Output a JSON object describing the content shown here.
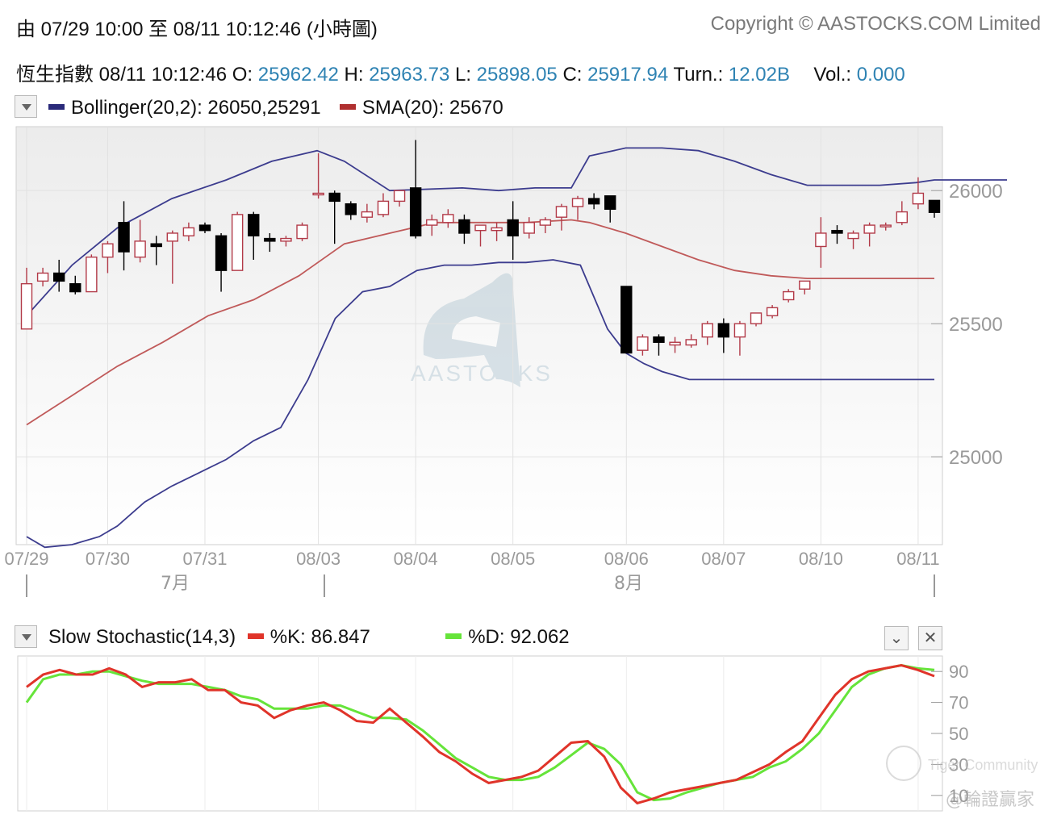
{
  "header": {
    "range_text": "由  07/29 10:00 至  08/11 10:12:46 (小時圖)",
    "copyright": "Copyright © AASTOCKS.COM Limited"
  },
  "quote": {
    "name": "恆生指數",
    "time": "08/11 10:12:46",
    "o_label": "O:",
    "o": "25962.42",
    "h_label": "H:",
    "h": "25963.73",
    "l_label": "L:",
    "l": "25898.05",
    "c_label": "C:",
    "c": "25917.94",
    "turn_label": "Turn.:",
    "turn": "12.02B",
    "vol_label": "Vol.:",
    "vol": "0.000"
  },
  "legend_main": {
    "boll_text": "Bollinger(20,2): 26050,25291",
    "sma_text": "SMA(20): 25670"
  },
  "legend_stoch": {
    "title": "Slow Stochastic(14,3)",
    "k_text": "%K: 86.847",
    "d_text": "%D: 92.062"
  },
  "watermark": {
    "logo_text": "AASTOCKS",
    "tiger_text": "Tiger Community",
    "handle_text": "@輪證贏家"
  },
  "colors": {
    "up": "#b23a48",
    "down": "#000000",
    "boll": "#3c3c8e",
    "sma": "#c05a5a",
    "k": "#e0342a",
    "d": "#66e43a",
    "label": "#9a9a9a"
  },
  "chart_data": [
    {
      "type": "candlestick",
      "title": "恆生指數",
      "x_ticks": [
        "07/29",
        "07/30",
        "07/31",
        "08/03",
        "08/04",
        "08/05",
        "08/06",
        "08/07",
        "08/10",
        "08/11"
      ],
      "months": [
        "7月",
        "8月"
      ],
      "y_ticks": [
        25000,
        25500,
        26000
      ],
      "ylim": [
        24670,
        26240
      ],
      "candles": [
        {
          "o": 25480,
          "h": 25710,
          "l": 25480,
          "c": 25650
        },
        {
          "o": 25660,
          "h": 25710,
          "l": 25640,
          "c": 25690
        },
        {
          "o": 25690,
          "h": 25740,
          "l": 25620,
          "c": 25660
        },
        {
          "o": 25650,
          "h": 25680,
          "l": 25610,
          "c": 25620
        },
        {
          "o": 25620,
          "h": 25760,
          "l": 25620,
          "c": 25750
        },
        {
          "o": 25750,
          "h": 25810,
          "l": 25690,
          "c": 25800
        },
        {
          "o": 25880,
          "h": 25960,
          "l": 25700,
          "c": 25770
        },
        {
          "o": 25750,
          "h": 25890,
          "l": 25730,
          "c": 25810
        },
        {
          "o": 25800,
          "h": 25830,
          "l": 25720,
          "c": 25790
        },
        {
          "o": 25810,
          "h": 25850,
          "l": 25650,
          "c": 25840
        },
        {
          "o": 25830,
          "h": 25880,
          "l": 25810,
          "c": 25860
        },
        {
          "o": 25870,
          "h": 25880,
          "l": 25840,
          "c": 25850
        },
        {
          "o": 25830,
          "h": 25840,
          "l": 25620,
          "c": 25700
        },
        {
          "o": 25700,
          "h": 25920,
          "l": 25700,
          "c": 25910
        },
        {
          "o": 25910,
          "h": 25920,
          "l": 25740,
          "c": 25830
        },
        {
          "o": 25820,
          "h": 25840,
          "l": 25770,
          "c": 25810
        },
        {
          "o": 25810,
          "h": 25830,
          "l": 25790,
          "c": 25820
        },
        {
          "o": 25820,
          "h": 25880,
          "l": 25810,
          "c": 25870
        },
        {
          "o": 25990,
          "h": 26140,
          "l": 25970,
          "c": 25990
        },
        {
          "o": 25990,
          "h": 26000,
          "l": 25800,
          "c": 25960
        },
        {
          "o": 25950,
          "h": 25960,
          "l": 25890,
          "c": 25910
        },
        {
          "o": 25900,
          "h": 25950,
          "l": 25880,
          "c": 25920
        },
        {
          "o": 25910,
          "h": 25990,
          "l": 25900,
          "c": 25960
        },
        {
          "o": 25960,
          "h": 26000,
          "l": 25940,
          "c": 26000
        },
        {
          "o": 26010,
          "h": 26190,
          "l": 25820,
          "c": 25830
        },
        {
          "o": 25870,
          "h": 25910,
          "l": 25830,
          "c": 25890
        },
        {
          "o": 25880,
          "h": 25930,
          "l": 25860,
          "c": 25910
        },
        {
          "o": 25890,
          "h": 25910,
          "l": 25800,
          "c": 25840
        },
        {
          "o": 25850,
          "h": 25870,
          "l": 25790,
          "c": 25870
        },
        {
          "o": 25850,
          "h": 25880,
          "l": 25810,
          "c": 25860
        },
        {
          "o": 25890,
          "h": 25960,
          "l": 25740,
          "c": 25830
        },
        {
          "o": 25840,
          "h": 25900,
          "l": 25820,
          "c": 25880
        },
        {
          "o": 25870,
          "h": 25900,
          "l": 25840,
          "c": 25890
        },
        {
          "o": 25900,
          "h": 25950,
          "l": 25850,
          "c": 25940
        },
        {
          "o": 25940,
          "h": 25980,
          "l": 25890,
          "c": 25970
        },
        {
          "o": 25970,
          "h": 25990,
          "l": 25930,
          "c": 25950
        },
        {
          "o": 25980,
          "h": 25980,
          "l": 25880,
          "c": 25930
        },
        {
          "o": 25640,
          "h": 25640,
          "l": 25390,
          "c": 25390
        },
        {
          "o": 25400,
          "h": 25460,
          "l": 25380,
          "c": 25450
        },
        {
          "o": 25450,
          "h": 25460,
          "l": 25380,
          "c": 25430
        },
        {
          "o": 25420,
          "h": 25450,
          "l": 25390,
          "c": 25430
        },
        {
          "o": 25420,
          "h": 25460,
          "l": 25410,
          "c": 25440
        },
        {
          "o": 25450,
          "h": 25510,
          "l": 25420,
          "c": 25500
        },
        {
          "o": 25500,
          "h": 25520,
          "l": 25390,
          "c": 25450
        },
        {
          "o": 25450,
          "h": 25510,
          "l": 25380,
          "c": 25500
        },
        {
          "o": 25500,
          "h": 25540,
          "l": 25490,
          "c": 25540
        },
        {
          "o": 25530,
          "h": 25570,
          "l": 25520,
          "c": 25560
        },
        {
          "o": 25590,
          "h": 25630,
          "l": 25580,
          "c": 25620
        },
        {
          "o": 25630,
          "h": 25660,
          "l": 25610,
          "c": 25660
        },
        {
          "o": 25790,
          "h": 25900,
          "l": 25710,
          "c": 25840
        },
        {
          "o": 25850,
          "h": 25870,
          "l": 25800,
          "c": 25840
        },
        {
          "o": 25820,
          "h": 25850,
          "l": 25780,
          "c": 25840
        },
        {
          "o": 25840,
          "h": 25880,
          "l": 25790,
          "c": 25870
        },
        {
          "o": 25870,
          "h": 25880,
          "l": 25850,
          "c": 25870
        },
        {
          "o": 25880,
          "h": 25960,
          "l": 25870,
          "c": 25920
        },
        {
          "o": 25950,
          "h": 26050,
          "l": 25930,
          "c": 25990
        },
        {
          "o": 25963,
          "h": 25963,
          "l": 25898,
          "c": 25918
        }
      ],
      "series": [
        {
          "name": "Bollinger upper",
          "values": [
            25530,
            25580,
            25630,
            25700,
            25760,
            25780,
            25820,
            25850,
            25880,
            25920,
            25960,
            25990,
            26010,
            26040,
            26070,
            26080,
            26090,
            26100,
            26110,
            26130,
            26140,
            26120,
            26090,
            26060,
            26030,
            26000,
            25990,
            26000,
            26010,
            26010,
            26010,
            26010,
            26010,
            26010,
            26010,
            26010,
            26010,
            26010,
            26010,
            26010,
            26010,
            26010,
            26010,
            26010,
            26010,
            26010,
            26010,
            26010,
            26010,
            26010,
            26010,
            26010,
            26010,
            26010,
            26010,
            26010,
            26010,
            26010,
            26010,
            26010,
            26010,
            26010,
            26010,
            26010,
            26010,
            26010
          ]
        },
        {
          "name": "SMA",
          "values": [
            25120,
            25140,
            25170,
            25190,
            25210,
            25230,
            25250,
            25270,
            25300,
            25320,
            25340,
            25360,
            25380,
            25400,
            25420,
            25440,
            25460,
            25470,
            25490,
            25510,
            25530,
            25550,
            25560,
            25580,
            25600,
            25620,
            25640,
            25660,
            25710,
            25740,
            25760,
            25770,
            25780,
            25790,
            25800,
            25820,
            25840,
            25850,
            25860,
            25870,
            25870,
            25870,
            25870,
            25870,
            25870,
            25870,
            25870,
            25870,
            25870,
            25870,
            25870,
            25870,
            25870,
            25870,
            25870,
            25870,
            25870,
            25870,
            25870,
            25870,
            25870,
            25870,
            25870,
            25870,
            25870,
            25870
          ]
        }
      ],
      "bollinger_upper": {
        "x": [
          0,
          5,
          10,
          16,
          22,
          27,
          32,
          35,
          40,
          48,
          52,
          56,
          60,
          62,
          66,
          70,
          74,
          78,
          82,
          86,
          90,
          94,
          98,
          100,
          104,
          108
        ],
        "y": [
          25530,
          25720,
          25860,
          25970,
          26040,
          26110,
          26150,
          26110,
          26000,
          26010,
          26000,
          26010,
          26010,
          26130,
          26160,
          26160,
          26150,
          26110,
          26060,
          26020,
          26020,
          26020,
          26030,
          26040,
          26040,
          26040
        ]
      },
      "bollinger_lower": {
        "x": [
          0,
          2,
          5,
          8,
          10,
          13,
          16,
          19,
          22,
          25,
          28,
          31,
          34,
          37,
          40,
          43,
          46,
          49,
          52,
          55,
          58,
          61,
          64,
          66,
          68,
          70,
          73,
          76,
          79,
          82,
          85,
          88,
          92,
          96,
          100
        ],
        "y": [
          24700,
          24660,
          24670,
          24700,
          24740,
          24830,
          24890,
          24940,
          24990,
          25060,
          25110,
          25290,
          25520,
          25620,
          25640,
          25700,
          25720,
          25720,
          25730,
          25730,
          25740,
          25720,
          25480,
          25390,
          25350,
          25320,
          25290,
          25290,
          25290,
          25290,
          25290,
          25290,
          25290,
          25290,
          25290
        ]
      },
      "sma_line": {
        "x": [
          0,
          5,
          10,
          15,
          20,
          25,
          30,
          35,
          40,
          45,
          50,
          55,
          60,
          62,
          66,
          70,
          74,
          78,
          82,
          86,
          90,
          94,
          98,
          100
        ],
        "y": [
          25120,
          25230,
          25340,
          25430,
          25530,
          25590,
          25680,
          25800,
          25840,
          25880,
          25880,
          25880,
          25890,
          25880,
          25840,
          25790,
          25740,
          25700,
          25680,
          25670,
          25670,
          25670,
          25670,
          25670
        ]
      }
    },
    {
      "type": "line",
      "title": "Slow Stochastic(14,3)",
      "y_ticks": [
        10,
        30,
        50,
        70,
        90
      ],
      "ylim": [
        0,
        100
      ],
      "series": [
        {
          "name": "%K",
          "values": [
            80,
            88,
            91,
            88,
            88,
            92,
            88,
            80,
            83,
            83,
            85,
            78,
            78,
            70,
            68,
            60,
            65,
            68,
            70,
            65,
            58,
            57,
            66,
            57,
            48,
            38,
            32,
            24,
            18,
            20,
            22,
            26,
            35,
            44,
            45,
            35,
            15,
            5,
            8,
            12,
            14,
            16,
            18,
            20,
            25,
            30,
            38,
            45,
            60,
            75,
            85,
            90,
            92,
            94,
            91,
            87
          ]
        },
        {
          "name": "%D",
          "values": [
            70,
            85,
            88,
            88,
            90,
            90,
            87,
            84,
            82,
            82,
            82,
            80,
            78,
            74,
            72,
            66,
            66,
            66,
            68,
            68,
            64,
            60,
            60,
            59,
            52,
            43,
            34,
            28,
            22,
            20,
            20,
            22,
            28,
            36,
            44,
            40,
            30,
            12,
            7,
            8,
            12,
            15,
            18,
            20,
            22,
            28,
            32,
            40,
            50,
            65,
            80,
            88,
            92,
            94,
            92,
            91
          ]
        }
      ]
    }
  ]
}
